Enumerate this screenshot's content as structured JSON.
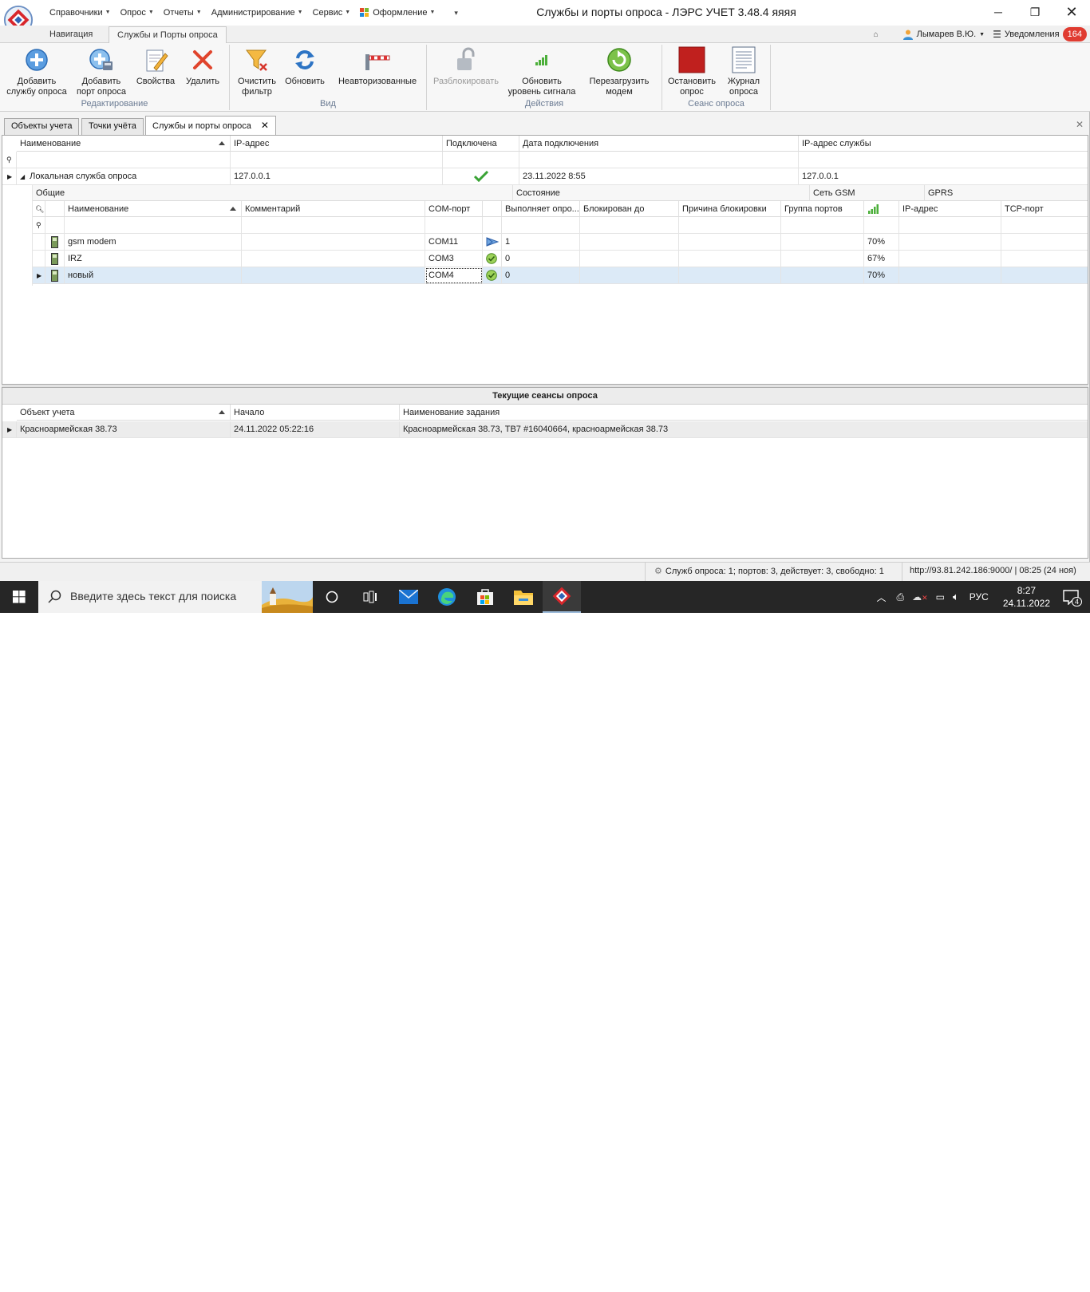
{
  "menu": [
    {
      "label": "Справочники",
      "caret": true
    },
    {
      "label": "Опрос",
      "caret": true
    },
    {
      "label": "Отчеты",
      "caret": true
    },
    {
      "label": "Администрирование",
      "caret": true
    },
    {
      "label": "Сервис",
      "caret": true
    },
    {
      "label": "Оформление",
      "caret": true
    }
  ],
  "window": {
    "title": "Службы и порты опроса - ЛЭРС УЧЕТ 3.48.4 яяяя"
  },
  "ribbon_tabs": {
    "nav": "Навигация",
    "services": "Службы и Порты опроса"
  },
  "user": {
    "name": "Лымарев В.Ю.",
    "notifications_label": "Уведомления",
    "notifications_count": "164"
  },
  "ribbon": {
    "add_service": "Добавить\nслужбу опроса",
    "add_port": "Добавить\nпорт опроса",
    "properties": "Свойства",
    "delete": "Удалить",
    "group_edit": "Редактирование",
    "clear_filter": "Очистить\nфильтр",
    "refresh": "Обновить",
    "unauthorized": "Неавторизованные",
    "group_view": "Вид",
    "unlock": "Разблокировать",
    "update_signal": "Обновить\nуровень сигнала",
    "reboot_modem": "Перезагрузить\nмодем",
    "group_actions": "Действия",
    "stop_poll": "Остановить\nопрос",
    "poll_log": "Журнал\nопроса",
    "group_session": "Сеанс опроса"
  },
  "doc_tabs": {
    "objects": "Объекты учета",
    "points": "Точки учёта",
    "services": "Службы и порты опроса"
  },
  "grid": {
    "headers": {
      "name": "Наименование",
      "ip": "IP-адрес",
      "connected": "Подключена",
      "date": "Дата подключения",
      "service_ip": "IP-адрес службы"
    },
    "service": {
      "name": "Локальная служба опроса",
      "ip": "127.0.0.1",
      "date": "23.11.2022 8:55",
      "service_ip": "127.0.0.1"
    },
    "bands": {
      "general": "Общие",
      "state": "Состояние",
      "gsm": "Сеть GSM",
      "gprs": "GPRS"
    },
    "sub_headers": {
      "name": "Наименование",
      "comment": "Комментарий",
      "com": "COM-порт",
      "polling": "Выполняет опро...",
      "blocked": "Блокирован до",
      "reason": "Причина блокировки",
      "group": "Группа портов",
      "ip": "IP-адрес",
      "tcp": "TCP-порт"
    },
    "ports": [
      {
        "name": "gsm modem",
        "com": "COM11",
        "status": "play",
        "polling": "1",
        "signal": "70%"
      },
      {
        "name": "IRZ",
        "com": "COM3",
        "status": "ok",
        "polling": "0",
        "signal": "67%"
      },
      {
        "name": "новый",
        "com": "COM4",
        "status": "ok",
        "polling": "0",
        "signal": "70%"
      }
    ]
  },
  "sessions": {
    "title": "Текущие сеансы опроса",
    "headers": {
      "object": "Объект учета",
      "start": "Начало",
      "task": "Наименование задания"
    },
    "rows": [
      {
        "object": "Красноармейская 38.73",
        "start": "24.11.2022 05:22:16",
        "task": "Красноармейская 38.73, ТВ7 #16040664, красноармейская 38.73"
      }
    ]
  },
  "status": {
    "summary": "Служб опроса: 1; портов: 3, действует: 3, свободно: 1",
    "server": "http://93.81.242.186:9000/ | 08:25 (24 ноя)"
  },
  "taskbar": {
    "search_placeholder": "Введите здесь текст для поиска",
    "lang": "РУС",
    "time": "8:27",
    "date": "24.11.2022",
    "notif_count": "4"
  },
  "colors": {
    "accent": "#3d6fb6",
    "badge": "#e03c31",
    "ok_green": "#3aa335",
    "stop_red": "#c0201e"
  }
}
